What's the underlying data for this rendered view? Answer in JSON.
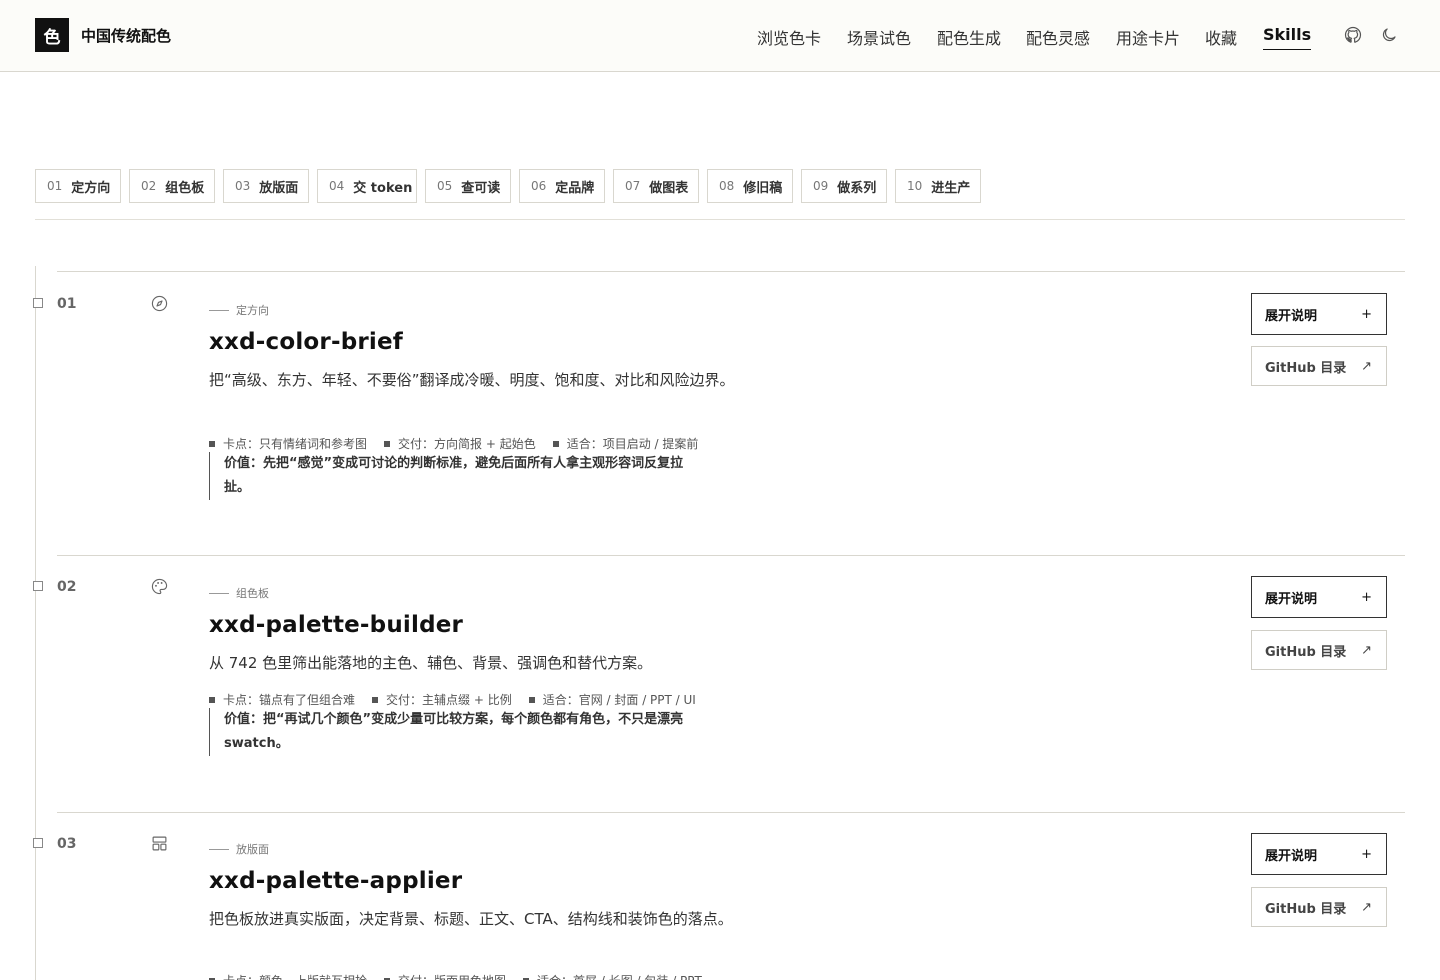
{
  "header": {
    "logo_char": "色",
    "title": "中国传统配色",
    "nav": [
      "浏览色卡",
      "场景试色",
      "配色生成",
      "配色灵感",
      "用途卡片",
      "收藏",
      "Skills"
    ],
    "active_nav": "Skills",
    "icons": [
      "github-icon",
      "moon-icon"
    ]
  },
  "steps": [
    {
      "num": "01",
      "label": "定方向"
    },
    {
      "num": "02",
      "label": "组色板"
    },
    {
      "num": "03",
      "label": "放版面"
    },
    {
      "num": "04",
      "label": "交 token"
    },
    {
      "num": "05",
      "label": "查可读"
    },
    {
      "num": "06",
      "label": "定品牌"
    },
    {
      "num": "07",
      "label": "做图表"
    },
    {
      "num": "08",
      "label": "修旧稿"
    },
    {
      "num": "09",
      "label": "做系列"
    },
    {
      "num": "10",
      "label": "进生产"
    }
  ],
  "skills": [
    {
      "num": "01",
      "icon": "compass-icon",
      "kicker": "定方向",
      "name": "xxd-color-brief",
      "desc": "把“高级、东方、年轻、不要俗”翻译成冷暖、明度、饱和度、对比和风险边界。",
      "meta": [
        "卡点：只有情绪词和参考图",
        "交付：方向简报 + 起始色",
        "适合：项目启动 / 提案前"
      ],
      "value": "价值：先把“感觉”变成可讨论的判断标准，避免后面所有人拿主观形容词反复拉扯。",
      "expand_label": "展开说明",
      "github_label": "GitHub 目录"
    },
    {
      "num": "02",
      "icon": "palette-icon",
      "kicker": "组色板",
      "name": "xxd-palette-builder",
      "desc": "从 742 色里筛出能落地的主色、辅色、背景、强调色和替代方案。",
      "meta": [
        "卡点：锚点有了但组合难",
        "交付：主辅点缀 + 比例",
        "适合：官网 / 封面 / PPT / UI"
      ],
      "value": "价值：把“再试几个颜色”变成少量可比较方案，每个颜色都有角色，不只是漂亮 swatch。",
      "expand_label": "展开说明",
      "github_label": "GitHub 目录"
    },
    {
      "num": "03",
      "icon": "layout-icon",
      "kicker": "放版面",
      "name": "xxd-palette-applier",
      "desc": "把色板放进真实版面，决定背景、标题、正文、CTA、结构线和装饰色的落点。",
      "meta": [
        "卡点：颜色一上版就互相抢",
        "交付：版面用色地图",
        "适合：首屏 / 长图 / 包装 / PPT"
      ],
      "value": "",
      "expand_label": "展开说明",
      "github_label": "GitHub 目录"
    }
  ]
}
